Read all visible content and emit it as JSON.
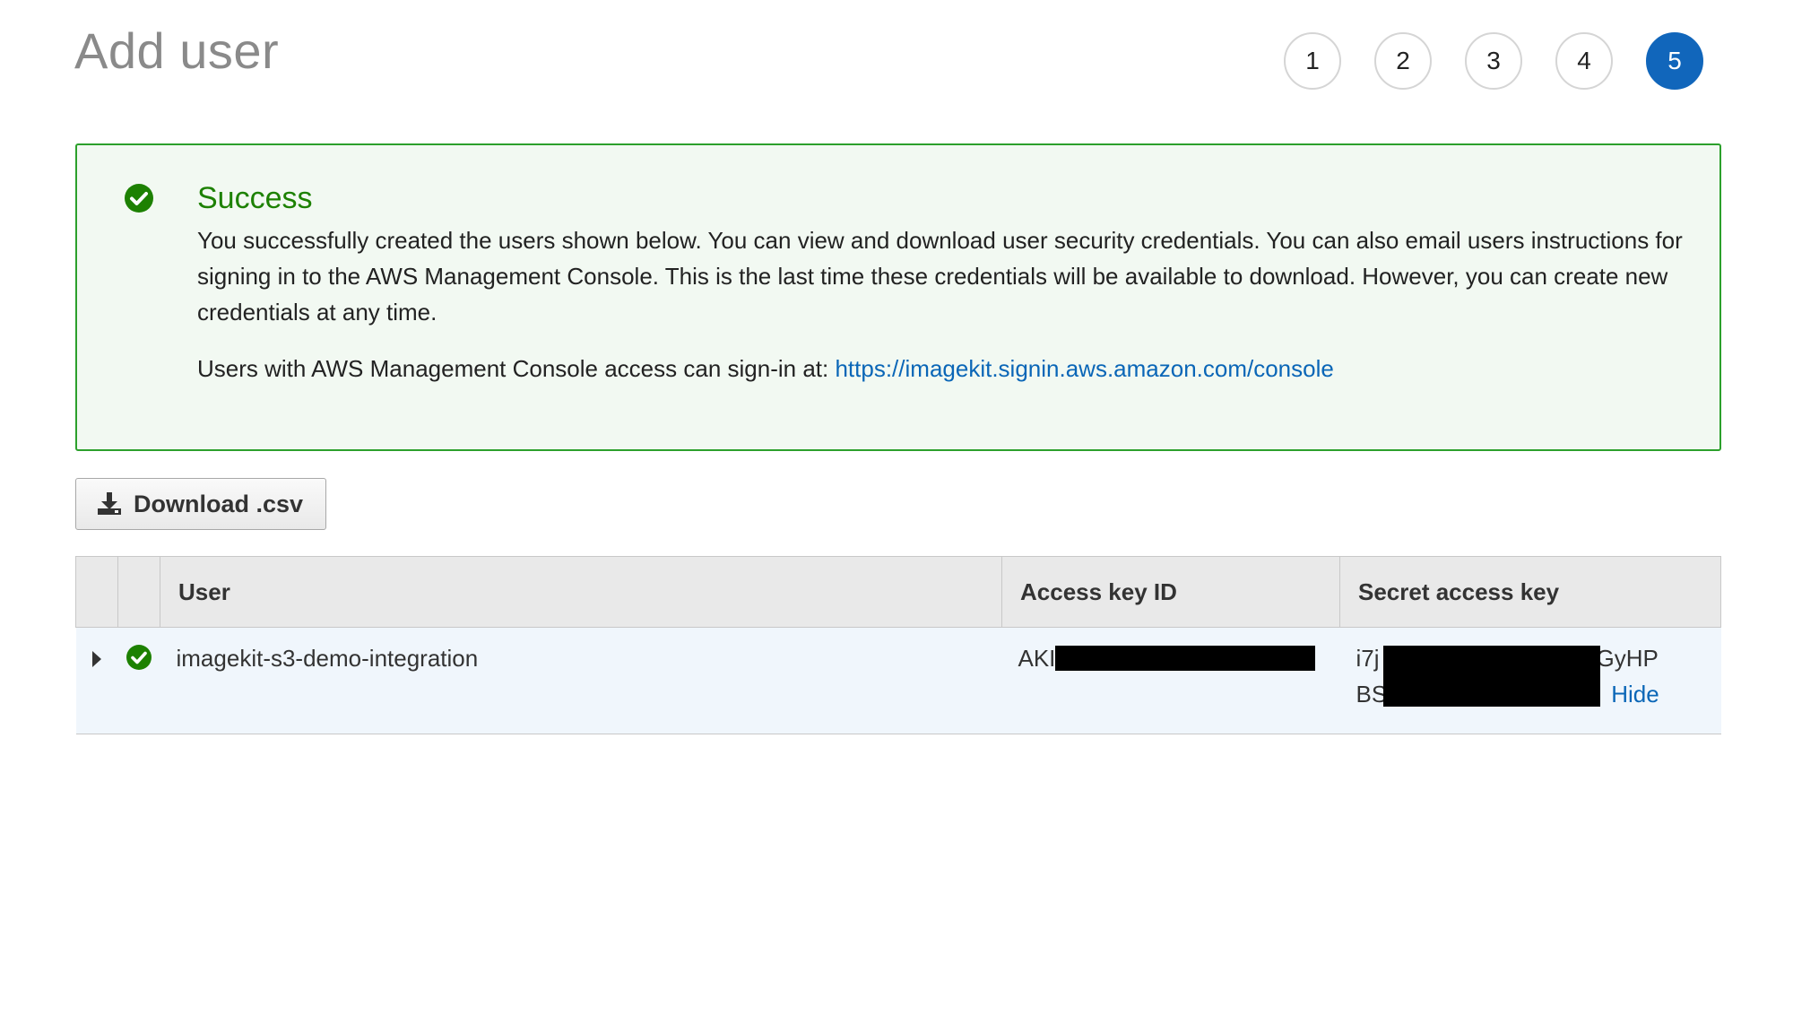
{
  "header": {
    "title": "Add user",
    "steps": [
      "1",
      "2",
      "3",
      "4",
      "5"
    ],
    "active_step": "5"
  },
  "alert": {
    "title": "Success",
    "body": "You successfully created the users shown below. You can view and download user security credentials. You can also email users instructions for signing in to the AWS Management Console. This is the last time these credentials will be available to download. However, you can create new credentials at any time.",
    "signin_prefix": "Users with AWS Management Console access can sign-in at: ",
    "signin_url": "https://imagekit.signin.aws.amazon.com/console",
    "icon": "check-circle-icon",
    "color": "#1d8102"
  },
  "toolbar": {
    "download_label": "Download .csv",
    "download_icon": "download-icon"
  },
  "table": {
    "headers": [
      "User",
      "Access key ID",
      "Secret access key"
    ],
    "rows": [
      {
        "user": "imagekit-s3-demo-integration",
        "access_key_prefix": "AKI",
        "secret_line1_prefix": "i7j",
        "secret_line1_suffix": "GyHP",
        "secret_line2_prefix": "BS",
        "hide_label": "Hide"
      }
    ]
  },
  "colors": {
    "accent": "#1166bb",
    "link": "#0a66b7",
    "success": "#2ca02c"
  }
}
